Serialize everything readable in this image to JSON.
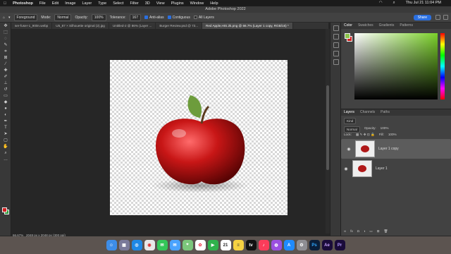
{
  "menubar": {
    "apple": "",
    "app": "Photoshop",
    "items": [
      "File",
      "Edit",
      "Image",
      "Layer",
      "Type",
      "Select",
      "Filter",
      "3D",
      "View",
      "Plugins",
      "Window",
      "Help"
    ],
    "clock": "Thu Jul 21  11:04 PM"
  },
  "titlebar": {
    "title": "Adobe Photoshop 2022"
  },
  "options": {
    "layer_select": "Foreground",
    "mode_label": "Mode:",
    "mode_value": "Normal",
    "opacity_label": "Opacity:",
    "opacity_value": "100%",
    "tolerance_label": "Tolerance:",
    "tolerance_value": "167",
    "antialias": "Anti-alias",
    "contiguous": "Contiguous",
    "all_layers": "All Layers",
    "share": "Share"
  },
  "tabs": [
    {
      "label": "ser-fuser-1_900n.webp",
      "active": false
    },
    {
      "label": "U5_87 × Silhouette original (2).jpg",
      "active": false
    },
    {
      "label": "Untitled-2 @ 86% (Layer ...",
      "active": false
    },
    {
      "label": "Burger Review.psd @ 73...",
      "active": false
    },
    {
      "label": "Red Apple,HIS.2k.png @ 66.7% (Layer 1 copy, RGB/16) *",
      "active": true
    }
  ],
  "status": {
    "zoom": "66.67%",
    "doc_info": "2048 px x 2048 px (300 ppi)"
  },
  "color_panel": {
    "tabs": [
      "Color",
      "Swatches",
      "Gradients",
      "Patterns"
    ],
    "fg_color": "#8bc34a",
    "bg_color": "#d12020",
    "hue_color": "#7bd12a"
  },
  "layers_panel": {
    "tabs": [
      "Layers",
      "Channels",
      "Paths"
    ],
    "kind": "Kind",
    "blend": "Normal",
    "opacity_label": "Opacity:",
    "opacity": "100%",
    "lock_label": "Lock:",
    "fill_label": "Fill:",
    "fill": "100%",
    "layers": [
      {
        "name": "Layer 1 copy",
        "selected": true
      },
      {
        "name": "Layer 1",
        "selected": false
      }
    ]
  },
  "toolbox": {
    "fg": "#d12020",
    "bg": "#2e9b3a"
  },
  "dock": [
    "finder-icon",
    "launchpad-icon",
    "safari-icon",
    "chrome-icon",
    "messages-icon",
    "mail-icon",
    "maps-icon",
    "photos-icon",
    "facetime-icon",
    "calendar-icon",
    "notes-icon",
    "tv-icon",
    "music-icon",
    "podcasts-icon",
    "appstore-icon",
    "settings-icon",
    "photoshop-icon",
    "aftereffects-icon",
    "premiere-icon"
  ]
}
